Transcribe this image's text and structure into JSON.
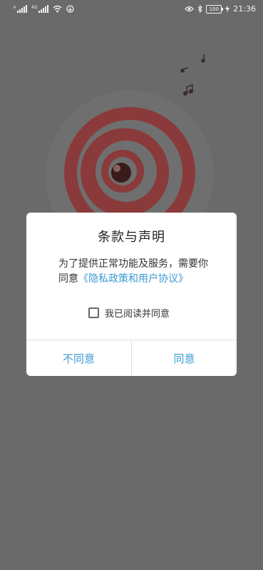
{
  "status_bar": {
    "sim1_tag": "×",
    "sim2_tag": "4G",
    "icons": [
      "signal-icon",
      "signal-icon",
      "wifi-icon",
      "notification-icon",
      "eye-icon",
      "bluetooth-icon",
      "battery-icon",
      "charging-icon"
    ],
    "battery": "100",
    "time": "21:36"
  },
  "dialog": {
    "title": "条款与声明",
    "message_prefix": "为了提供正常功能及服务，需要你同意",
    "message_link": "《隐私政策和用户协议》",
    "checkbox_label": "我已阅读并同意",
    "checkbox_checked": false,
    "disagree_button": "不同意",
    "agree_button": "同意"
  },
  "colors": {
    "overlay": "#6a6a6a",
    "accent": "#3a9bd4",
    "logo": "#8a3a3a"
  }
}
